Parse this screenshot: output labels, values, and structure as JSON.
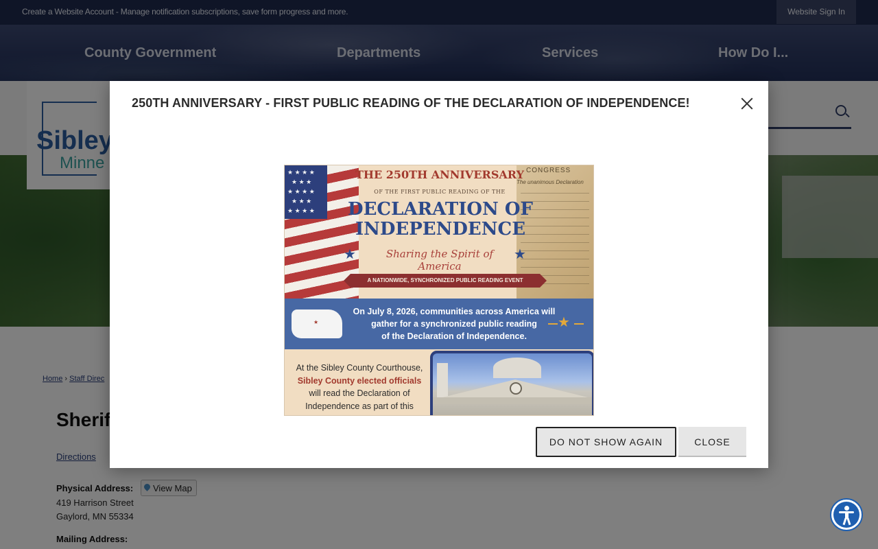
{
  "header": {
    "account_text": "Create a Website Account - Manage notification subscriptions, save form progress and more.",
    "sign_in_label": "Website Sign In",
    "nav": [
      {
        "label": "County Government"
      },
      {
        "label": "Departments"
      },
      {
        "label": "Services"
      },
      {
        "label": "How Do I..."
      }
    ]
  },
  "logo": {
    "word": "Sibley",
    "sub": "Minne"
  },
  "search": {
    "icon": "search-icon"
  },
  "breadcrumb": {
    "home": "Home",
    "staff": "Staff Direc"
  },
  "page": {
    "title": "Sherif",
    "directions_label": "Directions",
    "physical_address_label": "Physical Address:",
    "view_map_label": "View Map",
    "address_line1": "419 Harrison Street",
    "address_line2": "Gaylord, MN 55334",
    "mailing_address_label": "Mailing Address:"
  },
  "modal": {
    "title": "250TH ANNIVERSARY - FIRST PUBLIC READING OF THE DECLARATION OF INDEPENDENCE!",
    "close_icon": "close-icon",
    "dont_show_label": "DO NOT SHOW AGAIN",
    "close_label": "CLOSE",
    "flyer": {
      "line1": "THE 250TH ANNIVERSARY",
      "line2": "OF THE FIRST PUBLIC READING OF THE",
      "line3a": "DECLARATION OF",
      "line3b": "INDEPENDENCE",
      "script": "Sharing the Spirit of America",
      "banner": "A NATIONWIDE, SYNCHRONIZED PUBLIC READING EVENT",
      "blue_line1": "On July 8, 2026, communities across America will",
      "blue_line2": "gather for a  synchronized public reading",
      "blue_line3": "of the Declaration of Independence.",
      "bottom_line1": "At the Sibley County Courthouse,",
      "bottom_line2": "Sibley County elected officials",
      "bottom_line3": "will read the Declaration of",
      "bottom_line4": "Independence as part of this",
      "parchment_1": "CONGRESS",
      "parchment_2": "The unanimous Declaration"
    }
  },
  "accessibility": {
    "icon": "accessibility-icon"
  },
  "colors": {
    "header_bg": "#1f2a4e",
    "nav_text": "#d9dde8",
    "modal_title": "#2b2b2b",
    "flyer_blue": "#2d4a8a",
    "flyer_red": "#a23a2e",
    "a11y_blue": "#1f5fb0"
  }
}
